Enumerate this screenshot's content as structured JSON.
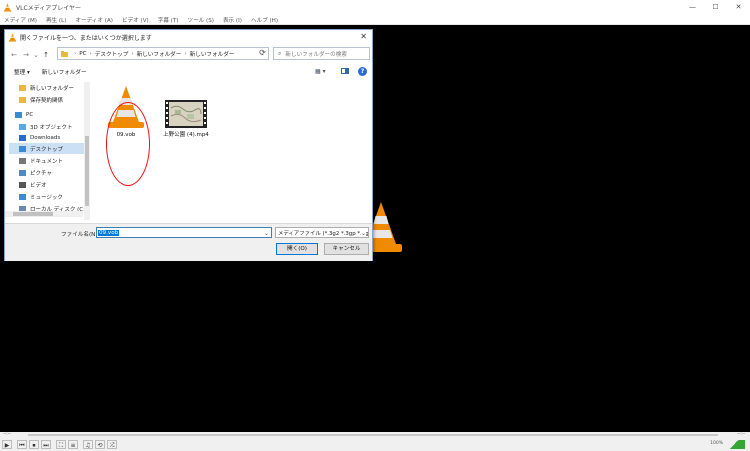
{
  "app": {
    "title": "VLCメディアプレイヤー",
    "window_buttons": [
      "—",
      "☐",
      "✕"
    ]
  },
  "menubar": [
    "メディア (M)",
    "再生 (L)",
    "オーディオ (A)",
    "ビデオ (V)",
    "字幕 (T)",
    "ツール (S)",
    "表示 (I)",
    "ヘルプ (H)"
  ],
  "dialog": {
    "title": "開くファイルを一つ、またはいくつか選択します",
    "close": "✕",
    "nav": {
      "back": "←",
      "forward": "→",
      "down": "⌄",
      "up": "↑"
    },
    "breadcrumb": [
      "PC",
      "デスクトップ",
      "新しいフォルダー",
      "新しいフォルダー"
    ],
    "breadcrumb_sep": "›",
    "search_placeholder": "新しいフォルダーの検索",
    "toolbar": {
      "organize": "整理 ▾",
      "new_folder": "新しいフォルダー"
    },
    "sidebar": [
      {
        "label": "新しいフォルダー",
        "icon": "folder-icon",
        "color": "#e8b93a"
      },
      {
        "label": "保存契約関係",
        "icon": "folder-icon",
        "color": "#e8b93a"
      },
      {
        "label": "PC",
        "icon": "pc-icon",
        "color": "#3a8ad8"
      },
      {
        "label": "3D オブジェクト",
        "icon": "3d-icon",
        "color": "#5aa8e0"
      },
      {
        "label": "Downloads",
        "icon": "download-icon",
        "color": "#2a6bd1"
      },
      {
        "label": "デスクトップ",
        "icon": "desktop-icon",
        "color": "#3a8ad8"
      },
      {
        "label": "ドキュメント",
        "icon": "document-icon",
        "color": "#777777"
      },
      {
        "label": "ピクチャ",
        "icon": "picture-icon",
        "color": "#4a8acb"
      },
      {
        "label": "ビデオ",
        "icon": "video-icon",
        "color": "#555555"
      },
      {
        "label": "ミュージック",
        "icon": "music-icon",
        "color": "#3a8ad8"
      },
      {
        "label": "ローカル ディスク (C:)",
        "icon": "disk-icon",
        "color": "#6a8ab0"
      }
    ],
    "files": [
      {
        "name": "09.vob"
      },
      {
        "name": "上野公園 (4).mp4"
      }
    ],
    "filename_label": "ファイル名(N):",
    "filename_value": "09.vob",
    "filetype_value": "メディアファイル (*.3g2 *.3gp *.3gp",
    "open_button": "開く(O)",
    "cancel_button": "キャンセル"
  },
  "player": {
    "time_left": "--:--",
    "time_right": "--:--",
    "volume_percent": "100%",
    "controls": [
      "▶",
      "⏮",
      "⏹",
      "⏭",
      "⛶",
      "≡",
      "♫",
      "⟲",
      "⤮"
    ]
  }
}
